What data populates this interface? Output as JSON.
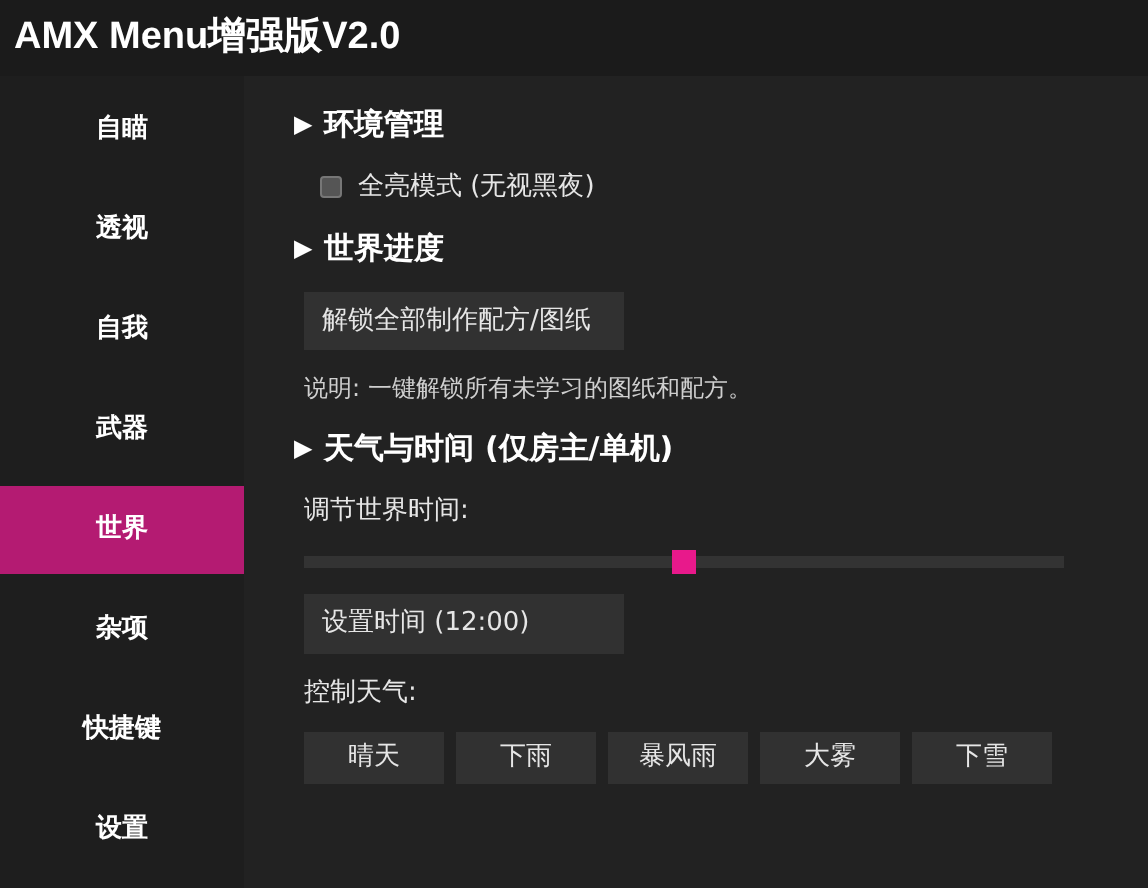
{
  "window": {
    "title": "AMX Menu增强版V2.0"
  },
  "sidebar": {
    "items": [
      {
        "label": "自瞄",
        "selected": false
      },
      {
        "label": "透视",
        "selected": false
      },
      {
        "label": "自我",
        "selected": false
      },
      {
        "label": "武器",
        "selected": false
      },
      {
        "label": "世界",
        "selected": true
      },
      {
        "label": "杂项",
        "selected": false
      },
      {
        "label": "快捷键",
        "selected": false
      },
      {
        "label": "设置",
        "selected": false
      }
    ]
  },
  "sections": [
    {
      "marker": "▶",
      "title": "环境管理",
      "items": [
        {
          "kind": "checkbox",
          "label": "全亮模式 (无视黑夜)",
          "checked": false
        }
      ]
    },
    {
      "marker": "▶",
      "title": "世界进度",
      "items": [
        {
          "kind": "button",
          "label": "解锁全部制作配方/图纸"
        },
        {
          "kind": "note",
          "text": "说明: 一键解锁所有未学习的图纸和配方。"
        }
      ]
    },
    {
      "marker": "▶",
      "title": "天气与时间 (仅房主/单机)",
      "items": [
        {
          "kind": "label",
          "text": "调节世界时间:"
        },
        {
          "kind": "slider",
          "level": 0.5
        },
        {
          "kind": "button",
          "label": "设置时间 (12:00)"
        },
        {
          "kind": "label",
          "text": "控制天气:"
        },
        {
          "kind": "buttons",
          "labels": [
            "晴天",
            "下雨",
            "暴风雨",
            "大雾",
            "下雪"
          ]
        }
      ]
    }
  ]
}
